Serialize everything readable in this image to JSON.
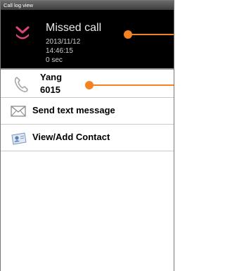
{
  "window": {
    "title": "Call log view"
  },
  "call": {
    "status": "Missed call",
    "date": "2013/11/12",
    "time": "14:46:15",
    "duration": "0 sec"
  },
  "contact": {
    "name": "Yang",
    "number": "6015"
  },
  "actions": [
    {
      "label": "Send text message",
      "icon": "envelope-icon"
    },
    {
      "label": "View/Add Contact",
      "icon": "contact-card-icon"
    }
  ],
  "colors": {
    "callout": "#f58220",
    "missed_icon": "#e0447a",
    "header_bg": "#000000"
  }
}
